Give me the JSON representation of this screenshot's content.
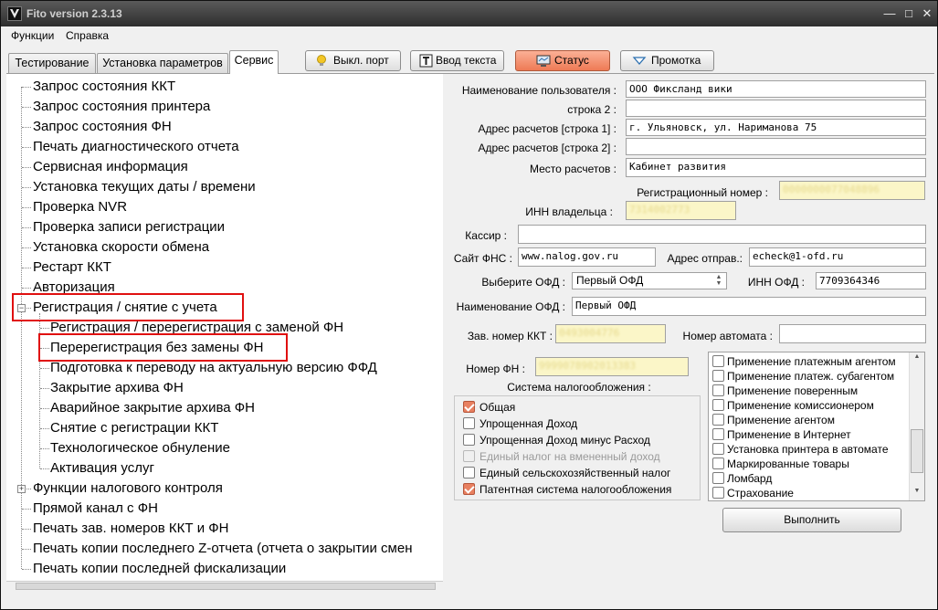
{
  "window": {
    "title": "Fito version 2.3.13"
  },
  "menu": [
    "Функции",
    "Справка"
  ],
  "tabs": [
    {
      "label": "Тестирование",
      "active": false
    },
    {
      "label": "Установка параметров",
      "active": false
    },
    {
      "label": "Сервис",
      "active": true
    }
  ],
  "toolbar": {
    "port_label": "Выкл. порт",
    "text_input_label": "Ввод текста",
    "status_label": "Статус",
    "feed_label": "Промотка"
  },
  "tree": {
    "items": [
      "Запрос состояния ККТ",
      "Запрос состояния принтера",
      "Запрос состояния ФН",
      "Печать диагностического отчета",
      "Сервисная информация",
      "Установка текущих даты / времени",
      "Проверка NVR",
      "Проверка записи регистрации",
      "Установка скорости обмена",
      "Рестарт ККТ",
      "Авторизация",
      "Регистрация / снятие с учета",
      "Регистрация / перерегистрация с заменой ФН",
      "Перерегистрация без замены ФН",
      "Подготовка к переводу на актуальную версию ФФД",
      "Закрытие архива ФН",
      "Аварийное закрытие архива ФН",
      "Снятие с регистрации ККТ",
      "Технологическое обнуление",
      "Активация услуг",
      "Функции налогового контроля",
      "Прямой канал с ФН",
      "Печать зав. номеров ККТ и ФН",
      "Печать копии последнего Z-отчета (отчета о закрытии смен",
      "Печать копии последней фискализации"
    ]
  },
  "form": {
    "user_name_label": "Наименование пользователя :",
    "user_name_value": "ООО Фиксланд вики",
    "line2_label": "строка 2 :",
    "line2_value": "",
    "addr1_label": "Адрес расчетов [строка 1] :",
    "addr1_value": "г. Ульяновск, ул. Нариманова 75",
    "addr2_label": "Адрес расчетов [строка 2] :",
    "addr2_value": "",
    "place_label": "Место расчетов :",
    "place_value": "Кабинет развития",
    "regnum_label": "Регистрационный номер :",
    "regnum_value": "0000000077048896",
    "inn_owner_label": "ИНН владельца :",
    "inn_owner_value": "7314002773",
    "cashier_label": "Кассир :",
    "cashier_value": "",
    "fns_site_label": "Сайт ФНС :",
    "fns_site_value": "www.nalog.gov.ru",
    "sender_addr_label": "Адрес отправ.:",
    "sender_addr_value": "echeck@1-ofd.ru",
    "ofd_select_label": "Выберите ОФД :",
    "ofd_select_value": "Первый ОФД",
    "inn_ofd_label": "ИНН ОФД :",
    "inn_ofd_value": "7709364346",
    "ofd_name_label": "Наименование ОФД :",
    "ofd_name_value": "Первый ОФД",
    "kkt_serial_label": "Зав. номер ККТ :",
    "kkt_serial_value": "0493004776",
    "machine_num_label": "Номер автомата :",
    "machine_num_value": "",
    "fn_num_label": "Номер ФН :",
    "fn_num_value": "9999078902013383",
    "tax_system_title": "Система налогообложения :",
    "tax_systems": [
      {
        "label": "Общая",
        "checked": true,
        "disabled": false
      },
      {
        "label": "Упрощенная Доход",
        "checked": false,
        "disabled": false
      },
      {
        "label": "Упрощенная Доход минус Расход",
        "checked": false,
        "disabled": false
      },
      {
        "label": "Единый налог на вмененный доход",
        "checked": false,
        "disabled": true
      },
      {
        "label": "Единый сельскохозяйственный налог",
        "checked": false,
        "disabled": false
      },
      {
        "label": "Патентная система налогообложения",
        "checked": true,
        "disabled": false
      }
    ],
    "features": [
      "Применение платежным агентом",
      "Применение платеж. субагентом",
      "Применение поверенным",
      "Применение комиссионером",
      "Применение агентом",
      "Применение в Интернет",
      "Установка принтера в автомате",
      "Маркированные товары",
      "Ломбард",
      "Страхование"
    ],
    "execute_label": "Выполнить"
  }
}
